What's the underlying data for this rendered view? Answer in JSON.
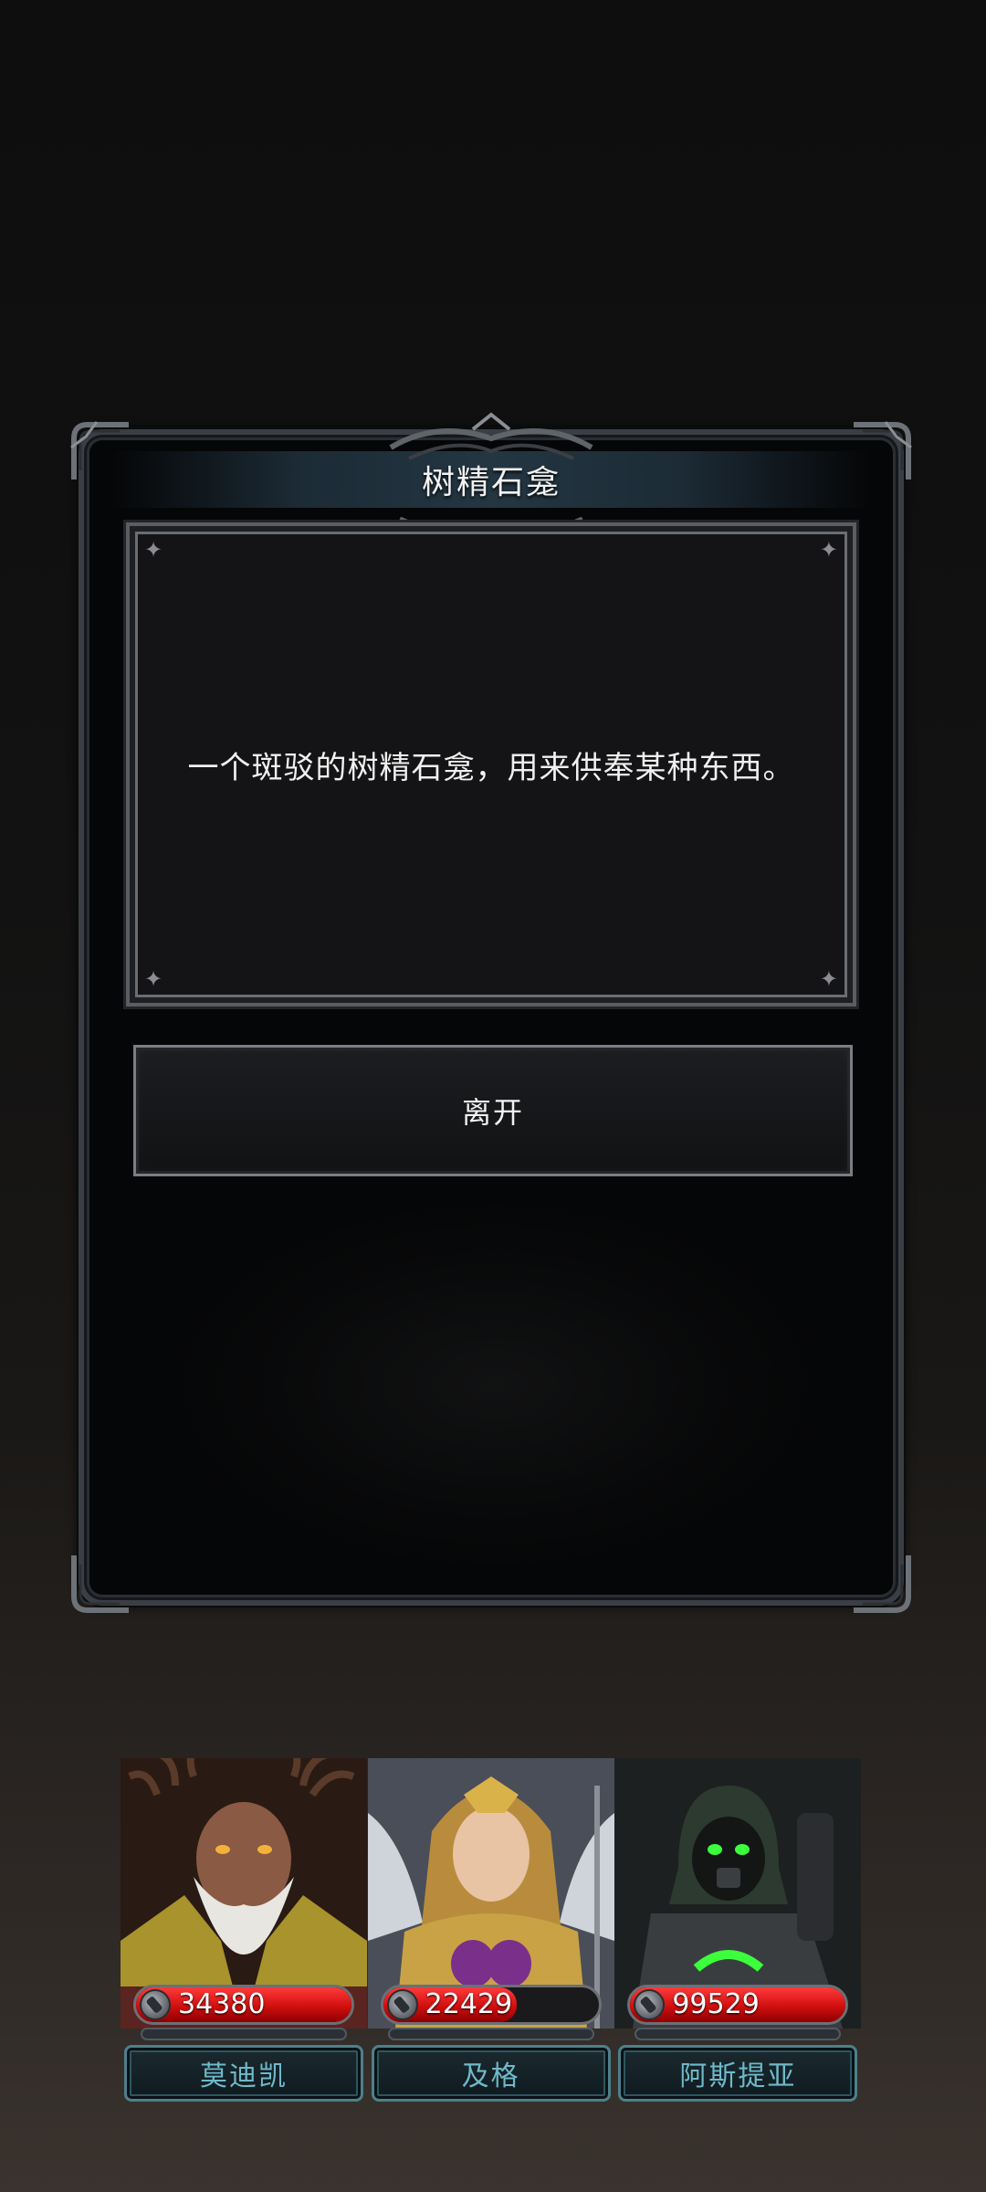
{
  "event": {
    "title": "树精石龛",
    "description": "一个斑驳的树精石龛，用来供奉某种东西。",
    "leave_label": "离开"
  },
  "party": [
    {
      "name": "莫迪凯",
      "hp": "34380",
      "hp_fraction": 1.0
    },
    {
      "name": "及格",
      "hp": "22429",
      "hp_fraction": 0.62
    },
    {
      "name": "阿斯提亚",
      "hp": "99529",
      "hp_fraction": 1.0
    }
  ],
  "colors": {
    "hp_red": "#d10f0f",
    "name_text": "#6fb9c9",
    "frame": "#3b3f45"
  }
}
